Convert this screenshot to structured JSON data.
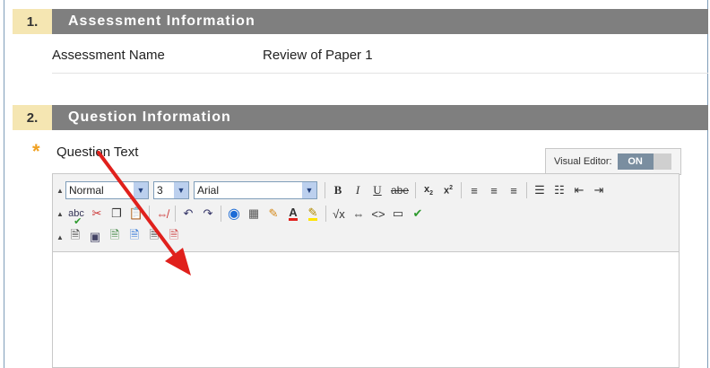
{
  "sections": [
    {
      "number": "1.",
      "title": "Assessment Information"
    },
    {
      "number": "2.",
      "title": "Question Information"
    }
  ],
  "assessment": {
    "name_label": "Assessment Name",
    "name_value": "Review of Paper 1"
  },
  "question": {
    "required_marker": "*",
    "label": "Question Text"
  },
  "visual_editor": {
    "label": "Visual Editor:",
    "state": "ON"
  },
  "toolbar": {
    "format_value": "Normal",
    "size_value": "3",
    "font_value": "Arial",
    "bold": "B",
    "italic": "I",
    "underline": "U",
    "strike": "abe",
    "spell": "abc"
  },
  "colors": {
    "section_bar": "#7f7f7f",
    "number_bg": "#f5e6b2",
    "required": "#f0a020",
    "annotation_arrow": "#e0201c"
  }
}
